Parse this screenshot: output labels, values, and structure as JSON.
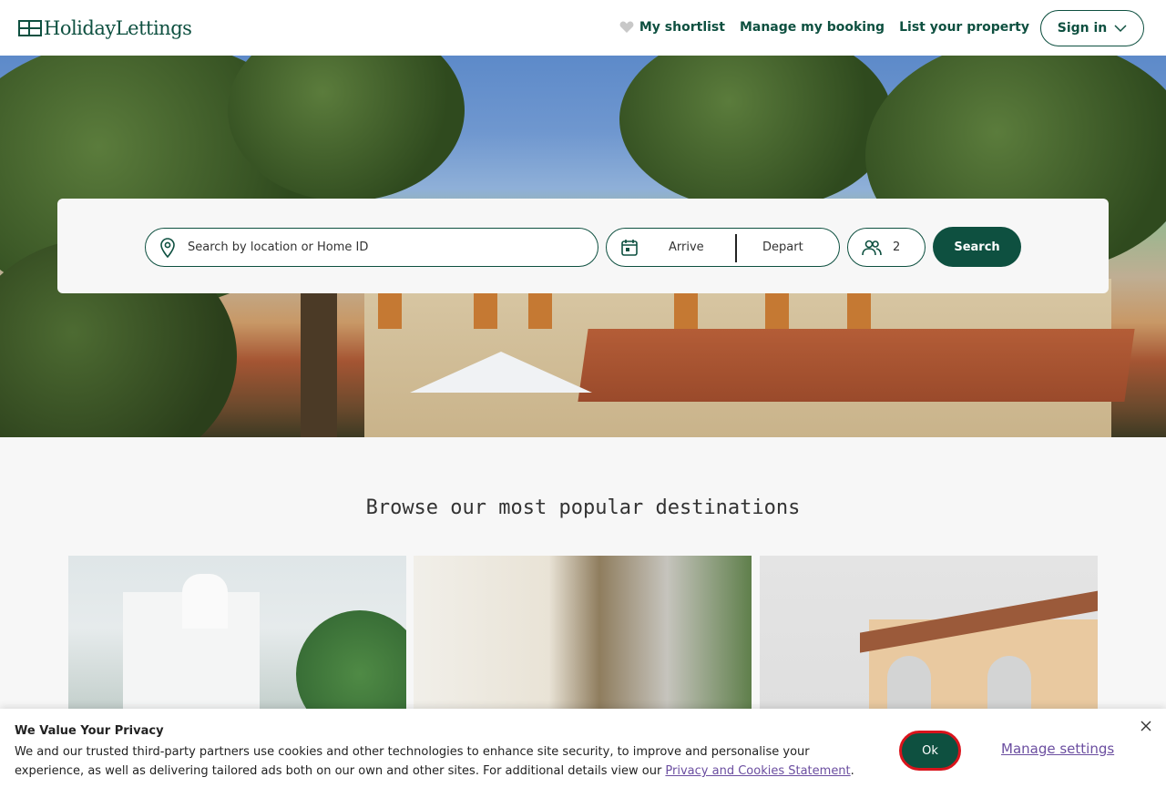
{
  "header": {
    "logo_text": "HolidayLettings",
    "nav": {
      "shortlist": "My shortlist",
      "manage_booking": "Manage my booking",
      "list_property": "List your property"
    },
    "sign_in": "Sign in"
  },
  "search": {
    "location_placeholder": "Search by location or Home ID",
    "arrive": "Arrive",
    "depart": "Depart",
    "guests": "2",
    "button": "Search"
  },
  "destinations": {
    "title": "Browse our most popular destinations"
  },
  "cookie_banner": {
    "title": "We Value Your Privacy",
    "text": "We and our trusted third-party partners use cookies and other technologies to enhance site security, to improve and personalise your experience, as well as delivering tailored ads both on our own and other sites. For additional details view our ",
    "link": "Privacy and Cookies Statement",
    "text_end": ".",
    "ok": "Ok",
    "manage": "Manage settings"
  },
  "colors": {
    "brand": "#0e5040",
    "link": "#6b4ea0",
    "ok_border": "#d9141c"
  },
  "icons": [
    "heart-icon",
    "chevron-down-icon",
    "location-pin-icon",
    "calendar-icon",
    "guests-icon",
    "close-icon"
  ]
}
